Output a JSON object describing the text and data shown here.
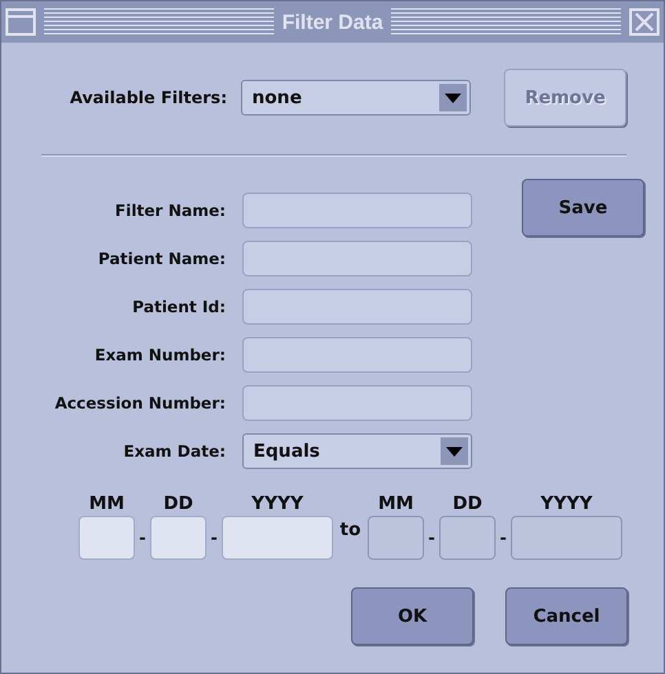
{
  "window": {
    "title": "Filter Data"
  },
  "available_filters": {
    "label": "Available Filters:",
    "value": "none"
  },
  "remove_button": {
    "label": "Remove",
    "disabled": true
  },
  "fields": [
    {
      "label": "Filter Name:",
      "kind": "text"
    },
    {
      "label": "Patient Name:",
      "kind": "text"
    },
    {
      "label": "Patient Id:",
      "kind": "text"
    },
    {
      "label": "Exam Number:",
      "kind": "text"
    },
    {
      "label": "Accession Number:",
      "kind": "text"
    },
    {
      "label": "Exam Date:",
      "kind": "dropdown",
      "value": "Equals"
    }
  ],
  "save_button": {
    "label": "Save",
    "disabled": false
  },
  "date_range": {
    "from": {
      "parts": [
        {
          "label": "MM",
          "disabled": false
        },
        {
          "label": "DD",
          "disabled": false
        },
        {
          "label": "YYYY",
          "disabled": false
        }
      ],
      "separators": [
        "-",
        "-"
      ]
    },
    "to_label": "to",
    "to": {
      "parts": [
        {
          "label": "MM",
          "disabled": true
        },
        {
          "label": "DD",
          "disabled": true
        },
        {
          "label": "YYYY",
          "disabled": true
        }
      ],
      "separators": [
        "-",
        "-"
      ]
    }
  },
  "buttons": [
    {
      "label": "OK",
      "disabled": false
    },
    {
      "label": "Cancel",
      "disabled": false
    }
  ]
}
